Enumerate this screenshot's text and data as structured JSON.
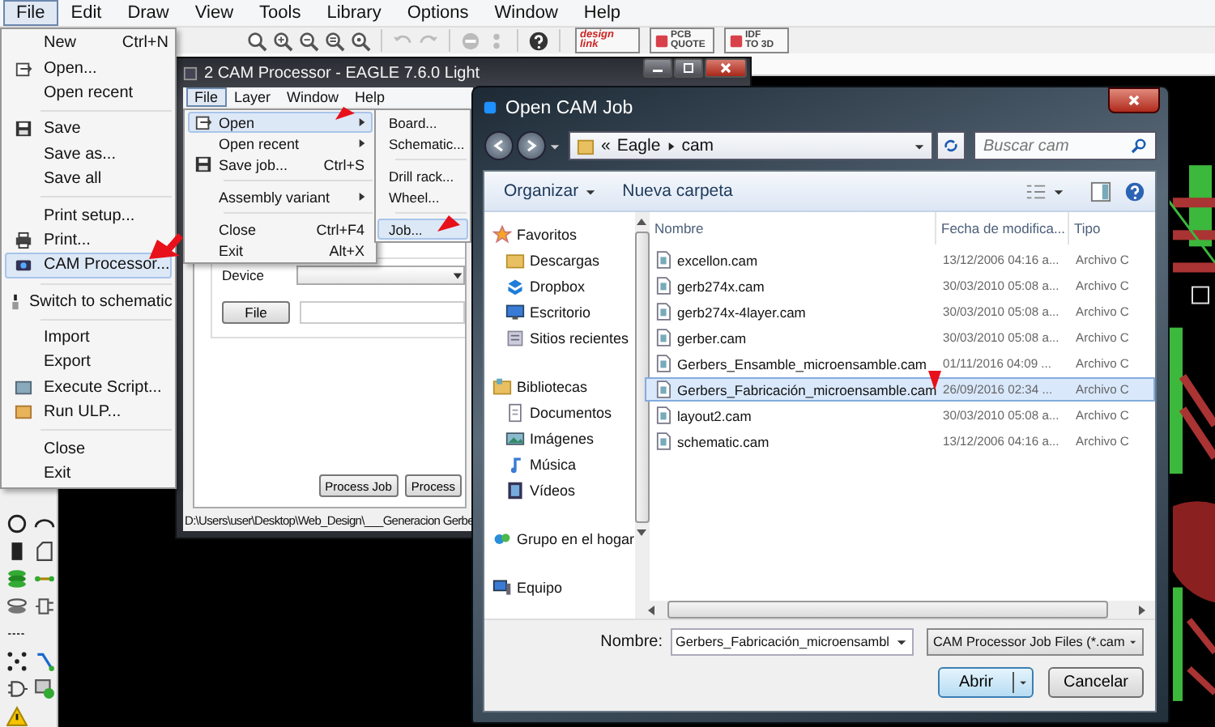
{
  "menubar": [
    {
      "label": "File",
      "selected": true
    },
    {
      "label": "Edit",
      "selected": false
    },
    {
      "label": "Draw",
      "selected": false
    },
    {
      "label": "View",
      "selected": false
    },
    {
      "label": "Tools",
      "selected": false
    },
    {
      "label": "Library",
      "selected": false
    },
    {
      "label": "Options",
      "selected": false
    },
    {
      "label": "Window",
      "selected": false
    },
    {
      "label": "Help",
      "selected": false
    }
  ],
  "toolbar_badges": [
    {
      "line1": "design",
      "line2": "link"
    },
    {
      "line1": "PCB",
      "line2": "QUOTE"
    },
    {
      "line1": "IDF",
      "line2": "TO 3D"
    }
  ],
  "file_menu": [
    {
      "kind": "item",
      "label": "New",
      "shortcut": "Ctrl+N",
      "selected": false
    },
    {
      "kind": "item",
      "label": "Open...",
      "selected": false
    },
    {
      "kind": "item",
      "label": "Open recent",
      "selected": false
    },
    {
      "kind": "separator"
    },
    {
      "kind": "item",
      "label": "Save",
      "selected": false
    },
    {
      "kind": "item",
      "label": "Save as...",
      "selected": false
    },
    {
      "kind": "item",
      "label": "Save all",
      "selected": false
    },
    {
      "kind": "separator"
    },
    {
      "kind": "item",
      "label": "Print setup...",
      "selected": false
    },
    {
      "kind": "item",
      "label": "Print...",
      "selected": false
    },
    {
      "kind": "item",
      "label": "CAM Processor...",
      "selected": true
    },
    {
      "kind": "separator"
    },
    {
      "kind": "item",
      "label": "Switch to schematic",
      "selected": false
    },
    {
      "kind": "separator"
    },
    {
      "kind": "item",
      "label": "Import",
      "selected": false
    },
    {
      "kind": "item",
      "label": "Export",
      "selected": false
    },
    {
      "kind": "item",
      "label": "Execute Script...",
      "selected": false
    },
    {
      "kind": "item",
      "label": "Run ULP...",
      "selected": false
    },
    {
      "kind": "separator"
    },
    {
      "kind": "item",
      "label": "Close",
      "selected": false
    },
    {
      "kind": "item",
      "label": "Exit",
      "selected": false
    }
  ],
  "cam_window": {
    "title": "2 CAM Processor - EAGLE 7.6.0 Light",
    "menubar": [
      {
        "label": "File",
        "selected": true
      },
      {
        "label": "Layer",
        "selected": false
      },
      {
        "label": "Window",
        "selected": false
      },
      {
        "label": "Help",
        "selected": false
      }
    ],
    "file_menu": [
      {
        "kind": "item",
        "label": "Open",
        "has_submenu": true,
        "selected": true
      },
      {
        "kind": "item",
        "label": "Open recent",
        "has_submenu": true,
        "selected": false
      },
      {
        "kind": "item",
        "label": "Save job...",
        "shortcut": "Ctrl+S",
        "has_submenu": false,
        "selected": false
      },
      {
        "kind": "separator"
      },
      {
        "kind": "item",
        "label": "Assembly variant",
        "has_submenu": true,
        "selected": false
      },
      {
        "kind": "separator"
      },
      {
        "kind": "item",
        "label": "Close",
        "shortcut": "Ctrl+F4",
        "has_submenu": false,
        "selected": false
      },
      {
        "kind": "item",
        "label": "Exit",
        "shortcut": "Alt+X",
        "has_submenu": false,
        "selected": false
      }
    ],
    "open_submenu": [
      {
        "kind": "item",
        "label": "Board...",
        "selected": false
      },
      {
        "kind": "item",
        "label": "Schematic...",
        "selected": false
      },
      {
        "kind": "separator"
      },
      {
        "kind": "item",
        "label": "Drill rack...",
        "selected": false
      },
      {
        "kind": "item",
        "label": "Wheel...",
        "selected": false
      },
      {
        "kind": "separator"
      },
      {
        "kind": "item",
        "label": "Job...",
        "selected": true
      }
    ],
    "device_label": "Device",
    "file_button": "File",
    "process_buttons": [
      "Process Job",
      "Process"
    ],
    "status": "D:\\Users\\user\\Desktop\\Web_Design\\___Generacion Gerbe"
  },
  "dialog": {
    "title": "Open CAM Job",
    "path_chevron": "«",
    "path": [
      "Eagle",
      "cam"
    ],
    "search_placeholder": "Buscar cam",
    "toolbar": [
      {
        "label": "Organizar",
        "dropdown": true
      },
      {
        "label": "Nueva carpeta",
        "dropdown": false
      }
    ],
    "nav": [
      {
        "kind": "group",
        "label": "Favoritos"
      },
      {
        "kind": "item",
        "label": "Descargas"
      },
      {
        "kind": "item",
        "label": "Dropbox"
      },
      {
        "kind": "item",
        "label": "Escritorio"
      },
      {
        "kind": "item",
        "label": "Sitios recientes"
      },
      {
        "kind": "group",
        "label": "Bibliotecas"
      },
      {
        "kind": "item",
        "label": "Documentos"
      },
      {
        "kind": "item",
        "label": "Imágenes"
      },
      {
        "kind": "item",
        "label": "Música"
      },
      {
        "kind": "item",
        "label": "Vídeos"
      },
      {
        "kind": "group",
        "label": "Grupo en el hogar"
      },
      {
        "kind": "group",
        "label": "Equipo"
      }
    ],
    "columns": [
      "Nombre",
      "Fecha de modifica...",
      "Tipo"
    ],
    "files": [
      {
        "name": "excellon.cam",
        "date": "13/12/2006 04:16 a...",
        "type": "Archivo C",
        "selected": false
      },
      {
        "name": "gerb274x.cam",
        "date": "30/03/2010 05:08 a...",
        "type": "Archivo C",
        "selected": false
      },
      {
        "name": "gerb274x-4layer.cam",
        "date": "30/03/2010 05:08 a...",
        "type": "Archivo C",
        "selected": false
      },
      {
        "name": "gerber.cam",
        "date": "30/03/2010 05:08 a...",
        "type": "Archivo C",
        "selected": false
      },
      {
        "name": "Gerbers_Ensamble_microensamble.cam",
        "date": "01/11/2016 04:09 ...",
        "type": "Archivo C",
        "selected": false
      },
      {
        "name": "Gerbers_Fabricación_microensamble.cam",
        "date": "26/09/2016 02:34 ...",
        "type": "Archivo C",
        "selected": true
      },
      {
        "name": "layout2.cam",
        "date": "30/03/2010 05:08 a...",
        "type": "Archivo C",
        "selected": false
      },
      {
        "name": "schematic.cam",
        "date": "13/12/2006 04:16 a...",
        "type": "Archivo C",
        "selected": false
      }
    ],
    "filename_label": "Nombre:",
    "filename": "Gerbers_Fabricación_microensambl",
    "filetype": "CAM Processor Job Files (*.cam",
    "buttons": [
      "Abrir",
      "Cancelar"
    ]
  }
}
